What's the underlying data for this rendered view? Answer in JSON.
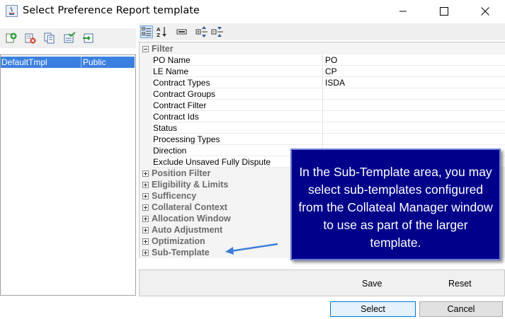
{
  "window": {
    "title": "Select Preference Report template"
  },
  "left_list": {
    "rows": [
      {
        "name": "DefaultTmpl",
        "access": "Public"
      }
    ]
  },
  "groups": [
    {
      "label": "Filter",
      "expanded": true,
      "rows": [
        {
          "name": "PO Name",
          "value": "PO"
        },
        {
          "name": "LE Name",
          "value": "CP"
        },
        {
          "name": "Contract Types",
          "value": "ISDA"
        },
        {
          "name": "Contract Groups",
          "value": ""
        },
        {
          "name": "Contract Filter",
          "value": ""
        },
        {
          "name": "Contract Ids",
          "value": ""
        },
        {
          "name": "Status",
          "value": ""
        },
        {
          "name": "Processing Types",
          "value": ""
        },
        {
          "name": "Direction",
          "value": ""
        },
        {
          "name": "Exclude Unsaved Fully Dispute",
          "value": ""
        }
      ]
    },
    {
      "label": "Position Filter",
      "expanded": false
    },
    {
      "label": "Eligibility & Limits",
      "expanded": false
    },
    {
      "label": "Sufficency",
      "expanded": false
    },
    {
      "label": "Collateral Context",
      "expanded": false
    },
    {
      "label": "Allocation Window",
      "expanded": false
    },
    {
      "label": "Auto Adjustment",
      "expanded": false
    },
    {
      "label": "Optimization",
      "expanded": false
    },
    {
      "label": "Sub-Template",
      "expanded": false
    }
  ],
  "buttons": {
    "save": "Save",
    "reset": "Reset",
    "select": "Select",
    "cancel": "Cancel"
  },
  "callout": {
    "text": "In the Sub-Template area, you may select sub-templates configured from the Collateal Manager window to use as part of the larger template."
  },
  "colors": {
    "selection": "#3b80e0",
    "callout_bg": "#00008b",
    "arrow": "#3d7fd8"
  }
}
